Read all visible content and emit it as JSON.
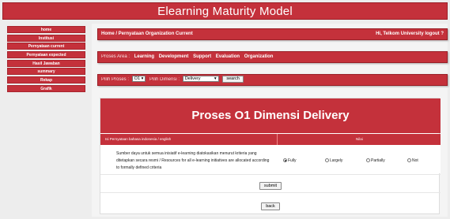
{
  "app": {
    "title": "Elearning Maturity Model"
  },
  "sidebar": {
    "items": [
      {
        "label": "home"
      },
      {
        "label": "Institusi"
      },
      {
        "label": "Pernyataan current"
      },
      {
        "label": "Pernyataan expected"
      },
      {
        "label": "Hasil Jawaban"
      },
      {
        "label": "summary"
      },
      {
        "label": "Rekap"
      },
      {
        "label": "Grafik"
      }
    ]
  },
  "header": {
    "breadcrumb": "Home / Pernyataan Organization Current",
    "greeting": "Hi, Telkom University",
    "logout": "logout ?"
  },
  "process_area": {
    "label": "Proses Area :",
    "links": [
      "Learning",
      "Development",
      "Support",
      "Evaluation",
      "Organization"
    ]
  },
  "filter": {
    "process_label": "Pilih Proses :",
    "process_value": "O1",
    "dimension_label": "Pilih Dimensi :",
    "dimension_value": "Delivery",
    "search_label": "search"
  },
  "panel": {
    "title": "Proses O1 Dimensi Delivery",
    "col_statement": "Isi Pernyataan bahasa indonesia / english",
    "col_value": "Nilai",
    "question": "Sumber daya untuk semua inisiatif e-learning diatokasikan menurut kriteria yang ditetapkan secara resmi / Resources for all e-learning initiatives are allocated according to formally defined criteria",
    "options": [
      {
        "label": "Fully",
        "selected": true
      },
      {
        "label": "Largely",
        "selected": false
      },
      {
        "label": "Partially",
        "selected": false
      },
      {
        "label": "Not",
        "selected": false
      }
    ],
    "submit_label": "submit",
    "back_label": "back"
  }
}
